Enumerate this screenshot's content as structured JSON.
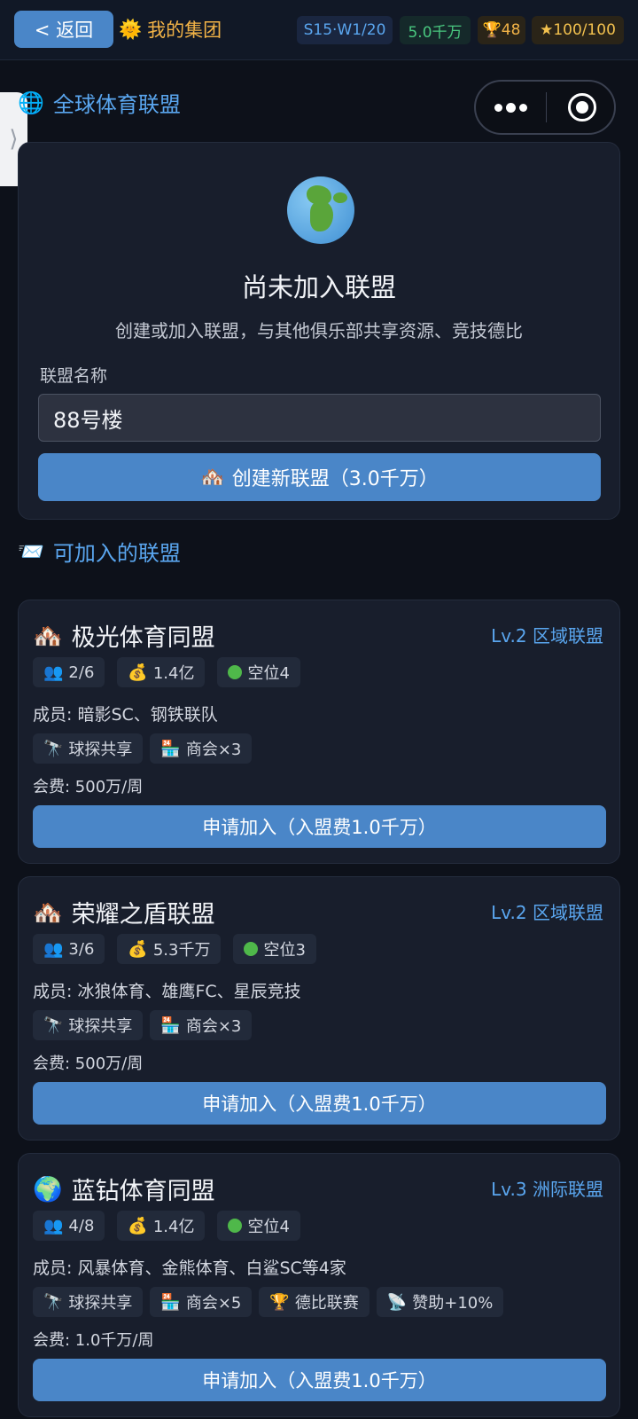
{
  "topbar": {
    "back_label": "< 返回",
    "group_icon": "sun-icon",
    "group_label": "我的集团",
    "season": "S15·W1/20",
    "money": "5.0千万",
    "trophy_icon": "trophy-icon",
    "trophies": "48",
    "star_icon": "star-icon",
    "stars": "100/100"
  },
  "global_section": {
    "icon": "globe-icon",
    "title": "全球体育联盟"
  },
  "status": {
    "title": "尚未加入联盟",
    "description": "创建或加入联盟，与其他俱乐部共享资源、竞技德比",
    "name_label": "联盟名称",
    "name_value": "88号楼",
    "create_label": "创建新联盟（3.0千万）"
  },
  "available_section": {
    "icon": "envelope-icon",
    "title": "可加入的联盟"
  },
  "leagues": [
    {
      "icon": "houses-icon",
      "name": "极光体育同盟",
      "level": "Lv.2 区域联盟",
      "members_count": "2/6",
      "funds": "1.4亿",
      "vacancy": "空位4",
      "members": "成员: 暗影SC、钢铁联队",
      "tags": [
        "球探共享",
        "商会×3"
      ],
      "fee": "会费: 500万/周",
      "apply_label": "申请加入（入盟费1.0千万）"
    },
    {
      "icon": "houses-icon",
      "name": "荣耀之盾联盟",
      "level": "Lv.2 区域联盟",
      "members_count": "3/6",
      "funds": "5.3千万",
      "vacancy": "空位3",
      "members": "成员: 冰狼体育、雄鹰FC、星辰竞技",
      "tags": [
        "球探共享",
        "商会×3"
      ],
      "fee": "会费: 500万/周",
      "apply_label": "申请加入（入盟费1.0千万）"
    },
    {
      "icon": "globe-icon",
      "name": "蓝钻体育同盟",
      "level": "Lv.3 洲际联盟",
      "members_count": "4/8",
      "funds": "1.4亿",
      "vacancy": "空位4",
      "members": "成员: 风暴体育、金熊体育、白鲨SC等4家",
      "tags": [
        "球探共享",
        "商会×5",
        "德比联赛",
        "赞助+10%"
      ],
      "fee": "会费: 1.0千万/周",
      "apply_label": "申请加入（入盟费1.0千万）"
    }
  ],
  "colors": {
    "accent": "#4a86c8",
    "link": "#5aa6ef",
    "gold": "#f2b347",
    "green": "#49c77f"
  }
}
